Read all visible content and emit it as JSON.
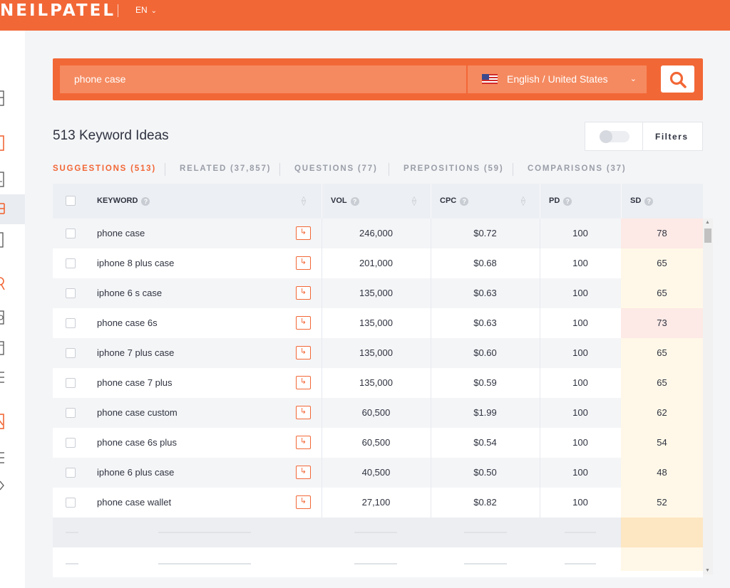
{
  "header": {
    "logo": "NEILPATEL",
    "language": "EN"
  },
  "search": {
    "query": "phone case",
    "locale": "English / United States"
  },
  "results": {
    "title": "513 Keyword Ideas",
    "filters_label": "Filters"
  },
  "tabs": [
    {
      "label": "SUGGESTIONS (513)",
      "active": true
    },
    {
      "label": "RELATED (37,857)",
      "active": false
    },
    {
      "label": "QUESTIONS (77)",
      "active": false
    },
    {
      "label": "PREPOSITIONS (59)",
      "active": false
    },
    {
      "label": "COMPARISONS (37)",
      "active": false
    }
  ],
  "table": {
    "headers": {
      "keyword": "KEYWORD",
      "vol": "VOL",
      "cpc": "CPC",
      "pd": "PD",
      "sd": "SD"
    },
    "rows": [
      {
        "keyword": "phone case",
        "vol": "246,000",
        "cpc": "$0.72",
        "pd": "100",
        "sd": "78"
      },
      {
        "keyword": "iphone 8 plus case",
        "vol": "201,000",
        "cpc": "$0.68",
        "pd": "100",
        "sd": "65"
      },
      {
        "keyword": "iphone 6 s case",
        "vol": "135,000",
        "cpc": "$0.63",
        "pd": "100",
        "sd": "65"
      },
      {
        "keyword": "phone case 6s",
        "vol": "135,000",
        "cpc": "$0.63",
        "pd": "100",
        "sd": "73"
      },
      {
        "keyword": "iphone 7 plus case",
        "vol": "135,000",
        "cpc": "$0.60",
        "pd": "100",
        "sd": "65"
      },
      {
        "keyword": "phone case 7 plus",
        "vol": "135,000",
        "cpc": "$0.59",
        "pd": "100",
        "sd": "65"
      },
      {
        "keyword": "phone case custom",
        "vol": "60,500",
        "cpc": "$1.99",
        "pd": "100",
        "sd": "62"
      },
      {
        "keyword": "phone case 6s plus",
        "vol": "60,500",
        "cpc": "$0.54",
        "pd": "100",
        "sd": "54"
      },
      {
        "keyword": "iphone 6 plus case",
        "vol": "40,500",
        "cpc": "$0.50",
        "pd": "100",
        "sd": "48"
      },
      {
        "keyword": "phone case wallet",
        "vol": "27,100",
        "cpc": "$0.82",
        "pd": "100",
        "sd": "52"
      }
    ]
  },
  "colors": {
    "brand": "#f26736",
    "sd_high": "#fde9e6",
    "sd_medium": "#fff8e8",
    "sd_loading": "#fde6c2"
  }
}
